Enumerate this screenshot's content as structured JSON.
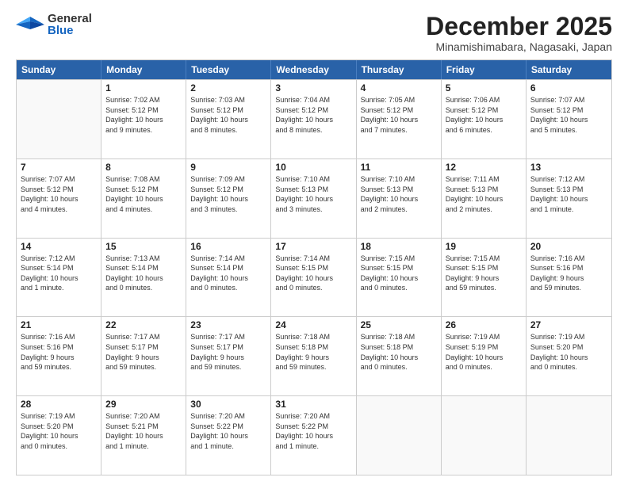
{
  "header": {
    "logo_general": "General",
    "logo_blue": "Blue",
    "title": "December 2025",
    "location": "Minamishimabara, Nagasaki, Japan"
  },
  "calendar": {
    "days": [
      "Sunday",
      "Monday",
      "Tuesday",
      "Wednesday",
      "Thursday",
      "Friday",
      "Saturday"
    ],
    "weeks": [
      [
        {
          "num": "",
          "info": ""
        },
        {
          "num": "1",
          "info": "Sunrise: 7:02 AM\nSunset: 5:12 PM\nDaylight: 10 hours\nand 9 minutes."
        },
        {
          "num": "2",
          "info": "Sunrise: 7:03 AM\nSunset: 5:12 PM\nDaylight: 10 hours\nand 8 minutes."
        },
        {
          "num": "3",
          "info": "Sunrise: 7:04 AM\nSunset: 5:12 PM\nDaylight: 10 hours\nand 8 minutes."
        },
        {
          "num": "4",
          "info": "Sunrise: 7:05 AM\nSunset: 5:12 PM\nDaylight: 10 hours\nand 7 minutes."
        },
        {
          "num": "5",
          "info": "Sunrise: 7:06 AM\nSunset: 5:12 PM\nDaylight: 10 hours\nand 6 minutes."
        },
        {
          "num": "6",
          "info": "Sunrise: 7:07 AM\nSunset: 5:12 PM\nDaylight: 10 hours\nand 5 minutes."
        }
      ],
      [
        {
          "num": "7",
          "info": "Sunrise: 7:07 AM\nSunset: 5:12 PM\nDaylight: 10 hours\nand 4 minutes."
        },
        {
          "num": "8",
          "info": "Sunrise: 7:08 AM\nSunset: 5:12 PM\nDaylight: 10 hours\nand 4 minutes."
        },
        {
          "num": "9",
          "info": "Sunrise: 7:09 AM\nSunset: 5:12 PM\nDaylight: 10 hours\nand 3 minutes."
        },
        {
          "num": "10",
          "info": "Sunrise: 7:10 AM\nSunset: 5:13 PM\nDaylight: 10 hours\nand 3 minutes."
        },
        {
          "num": "11",
          "info": "Sunrise: 7:10 AM\nSunset: 5:13 PM\nDaylight: 10 hours\nand 2 minutes."
        },
        {
          "num": "12",
          "info": "Sunrise: 7:11 AM\nSunset: 5:13 PM\nDaylight: 10 hours\nand 2 minutes."
        },
        {
          "num": "13",
          "info": "Sunrise: 7:12 AM\nSunset: 5:13 PM\nDaylight: 10 hours\nand 1 minute."
        }
      ],
      [
        {
          "num": "14",
          "info": "Sunrise: 7:12 AM\nSunset: 5:14 PM\nDaylight: 10 hours\nand 1 minute."
        },
        {
          "num": "15",
          "info": "Sunrise: 7:13 AM\nSunset: 5:14 PM\nDaylight: 10 hours\nand 0 minutes."
        },
        {
          "num": "16",
          "info": "Sunrise: 7:14 AM\nSunset: 5:14 PM\nDaylight: 10 hours\nand 0 minutes."
        },
        {
          "num": "17",
          "info": "Sunrise: 7:14 AM\nSunset: 5:15 PM\nDaylight: 10 hours\nand 0 minutes."
        },
        {
          "num": "18",
          "info": "Sunrise: 7:15 AM\nSunset: 5:15 PM\nDaylight: 10 hours\nand 0 minutes."
        },
        {
          "num": "19",
          "info": "Sunrise: 7:15 AM\nSunset: 5:15 PM\nDaylight: 9 hours\nand 59 minutes."
        },
        {
          "num": "20",
          "info": "Sunrise: 7:16 AM\nSunset: 5:16 PM\nDaylight: 9 hours\nand 59 minutes."
        }
      ],
      [
        {
          "num": "21",
          "info": "Sunrise: 7:16 AM\nSunset: 5:16 PM\nDaylight: 9 hours\nand 59 minutes."
        },
        {
          "num": "22",
          "info": "Sunrise: 7:17 AM\nSunset: 5:17 PM\nDaylight: 9 hours\nand 59 minutes."
        },
        {
          "num": "23",
          "info": "Sunrise: 7:17 AM\nSunset: 5:17 PM\nDaylight: 9 hours\nand 59 minutes."
        },
        {
          "num": "24",
          "info": "Sunrise: 7:18 AM\nSunset: 5:18 PM\nDaylight: 9 hours\nand 59 minutes."
        },
        {
          "num": "25",
          "info": "Sunrise: 7:18 AM\nSunset: 5:18 PM\nDaylight: 10 hours\nand 0 minutes."
        },
        {
          "num": "26",
          "info": "Sunrise: 7:19 AM\nSunset: 5:19 PM\nDaylight: 10 hours\nand 0 minutes."
        },
        {
          "num": "27",
          "info": "Sunrise: 7:19 AM\nSunset: 5:20 PM\nDaylight: 10 hours\nand 0 minutes."
        }
      ],
      [
        {
          "num": "28",
          "info": "Sunrise: 7:19 AM\nSunset: 5:20 PM\nDaylight: 10 hours\nand 0 minutes."
        },
        {
          "num": "29",
          "info": "Sunrise: 7:20 AM\nSunset: 5:21 PM\nDaylight: 10 hours\nand 1 minute."
        },
        {
          "num": "30",
          "info": "Sunrise: 7:20 AM\nSunset: 5:22 PM\nDaylight: 10 hours\nand 1 minute."
        },
        {
          "num": "31",
          "info": "Sunrise: 7:20 AM\nSunset: 5:22 PM\nDaylight: 10 hours\nand 1 minute."
        },
        {
          "num": "",
          "info": ""
        },
        {
          "num": "",
          "info": ""
        },
        {
          "num": "",
          "info": ""
        }
      ]
    ]
  }
}
